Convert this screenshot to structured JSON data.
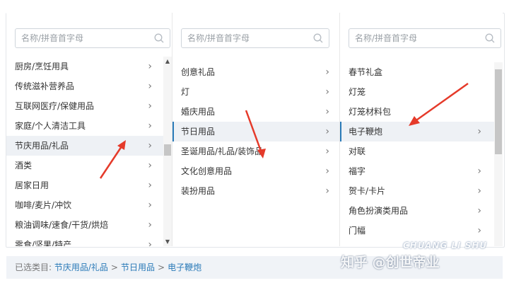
{
  "columns": [
    {
      "search_placeholder": "名称/拼音首字母",
      "items": [
        {
          "label": "厨房/烹饪用具",
          "has_children": true
        },
        {
          "label": "传统滋补营养品",
          "has_children": true
        },
        {
          "label": "互联网医疗/保健用品",
          "has_children": true
        },
        {
          "label": "家庭/个人清洁工具",
          "has_children": true
        },
        {
          "label": "节庆用品/礼品",
          "has_children": true,
          "selected": true
        },
        {
          "label": "酒类",
          "has_children": true
        },
        {
          "label": "居家日用",
          "has_children": true
        },
        {
          "label": "咖啡/麦片/冲饮",
          "has_children": true
        },
        {
          "label": "粮油调味/速食/干货/烘焙",
          "has_children": true
        },
        {
          "label": "零食/坚果/特产",
          "has_children": true
        }
      ]
    },
    {
      "search_placeholder": "名称/拼音首字母",
      "items": [
        {
          "label": "创意礼品",
          "has_children": true
        },
        {
          "label": "灯",
          "has_children": true
        },
        {
          "label": "婚庆用品",
          "has_children": true
        },
        {
          "label": "节日用品",
          "has_children": true,
          "selected": true
        },
        {
          "label": "圣诞用品/礼品/装饰品",
          "has_children": true
        },
        {
          "label": "文化创意用品",
          "has_children": true
        },
        {
          "label": "装扮用品",
          "has_children": true
        }
      ]
    },
    {
      "search_placeholder": "名称/拼音首字母",
      "items": [
        {
          "label": "春节礼盒",
          "has_children": false
        },
        {
          "label": "灯笼",
          "has_children": false
        },
        {
          "label": "灯笼材料包",
          "has_children": false
        },
        {
          "label": "电子鞭炮",
          "has_children": true,
          "selected": true
        },
        {
          "label": "对联",
          "has_children": false
        },
        {
          "label": "福字",
          "has_children": true
        },
        {
          "label": "贺卡/卡片",
          "has_children": true
        },
        {
          "label": "角色扮演类用品",
          "has_children": true
        },
        {
          "label": "门幅",
          "has_children": true
        }
      ]
    }
  ],
  "footer": {
    "prefix": "已选类目:",
    "path": [
      "节庆用品/礼品",
      "节日用品",
      "电子鞭炮"
    ],
    "separator": ">"
  },
  "watermark": {
    "line1": "CHUANG LI SHU",
    "line2": "知乎 @创世帝业"
  },
  "colors": {
    "accent": "#2a7ab8",
    "arrow": "#e53a2a",
    "selected_bg": "#eef1f5"
  }
}
